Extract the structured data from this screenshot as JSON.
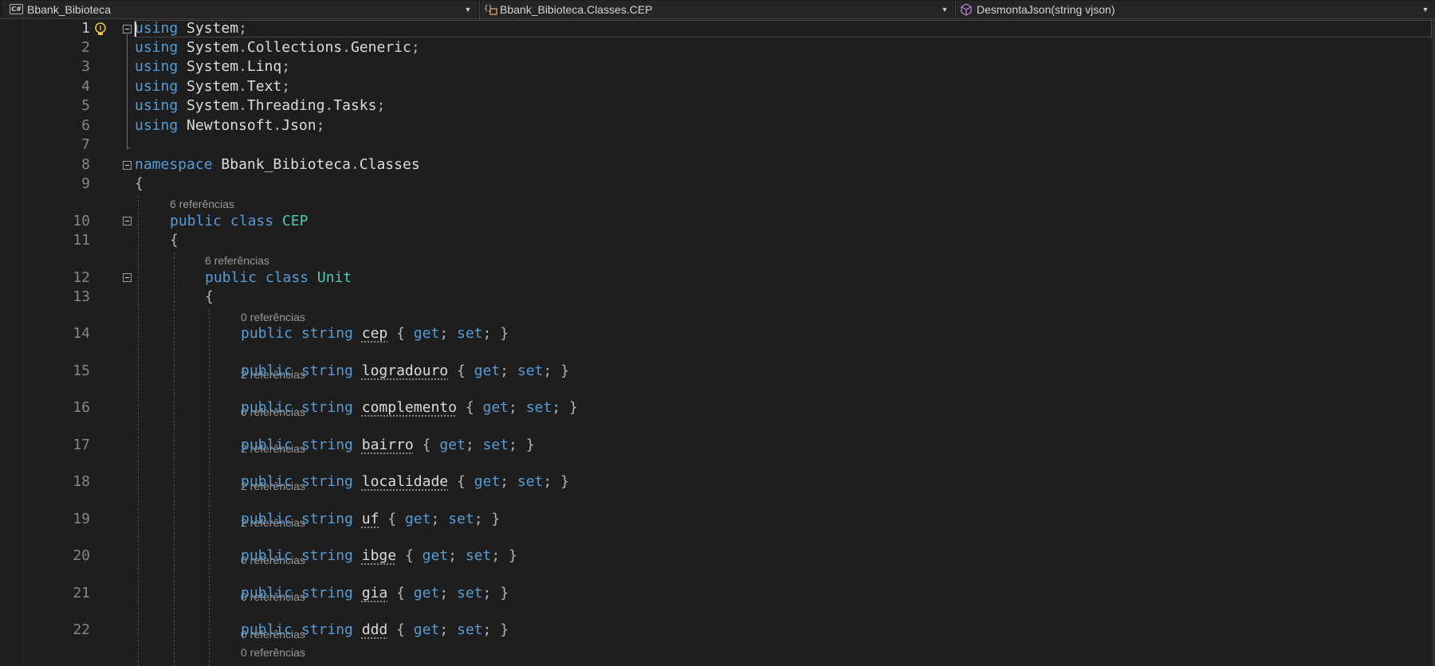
{
  "navbar": {
    "project": "Bbank_Bibioteca",
    "type": "Bbank_Bibioteca.Classes.CEP",
    "member": "DesmontaJson(string vjson)",
    "project_icon": "csharp-project-icon",
    "type_icon": "namespace-class-icon",
    "member_icon": "method-cube-icon"
  },
  "lines": {
    "l1": "1",
    "l2": "2",
    "l3": "3",
    "l4": "4",
    "l5": "5",
    "l6": "6",
    "l7": "7",
    "l8": "8",
    "l9": "9",
    "l10": "10",
    "l11": "11",
    "l12": "12",
    "l13": "13",
    "l14": "14",
    "l15": "15",
    "l16": "16",
    "l17": "17",
    "l18": "18",
    "l19": "19",
    "l20": "20",
    "l21": "21",
    "l22": "22"
  },
  "code": {
    "kw_using": "using",
    "kw_namespace": "namespace",
    "kw_public": "public",
    "kw_class": "class",
    "kw_string": "string",
    "kw_get": "get",
    "kw_set": "set",
    "u1": "System",
    "u2a": "System",
    "u2b": "Collections",
    "u2c": "Generic",
    "u3a": "System",
    "u3b": "Linq",
    "u4a": "System",
    "u4b": "Text",
    "u5a": "System",
    "u5b": "Threading",
    "u5c": "Tasks",
    "u6a": "Newtonsoft",
    "u6b": "Json",
    "ns_a": "Bbank_Bibioteca",
    "ns_b": "Classes",
    "class_cep": "CEP",
    "class_unit": "Unit",
    "p14": "cep",
    "p15": "logradouro",
    "p16": "complemento",
    "p17": "bairro",
    "p18": "localidade",
    "p19": "uf",
    "p20": "ibge",
    "p21": "gia",
    "p22": "ddd"
  },
  "lens": {
    "r10": "6 referências",
    "r12": "6 referências",
    "r14": "0 referências",
    "r15": "2 referências",
    "r16": "0 referências",
    "r17": "2 referências",
    "r18": "2 referências",
    "r19": "2 referências",
    "r20": "0 referências",
    "r21": "0 referências",
    "r22": "0 referências",
    "r23": "0 referências"
  },
  "colors": {
    "background": "#1e1e1e",
    "keyword": "#569cd6",
    "type": "#4ec9b0",
    "identifier": "#dcdcdc",
    "line_number": "#858585",
    "codelens": "#999999"
  }
}
